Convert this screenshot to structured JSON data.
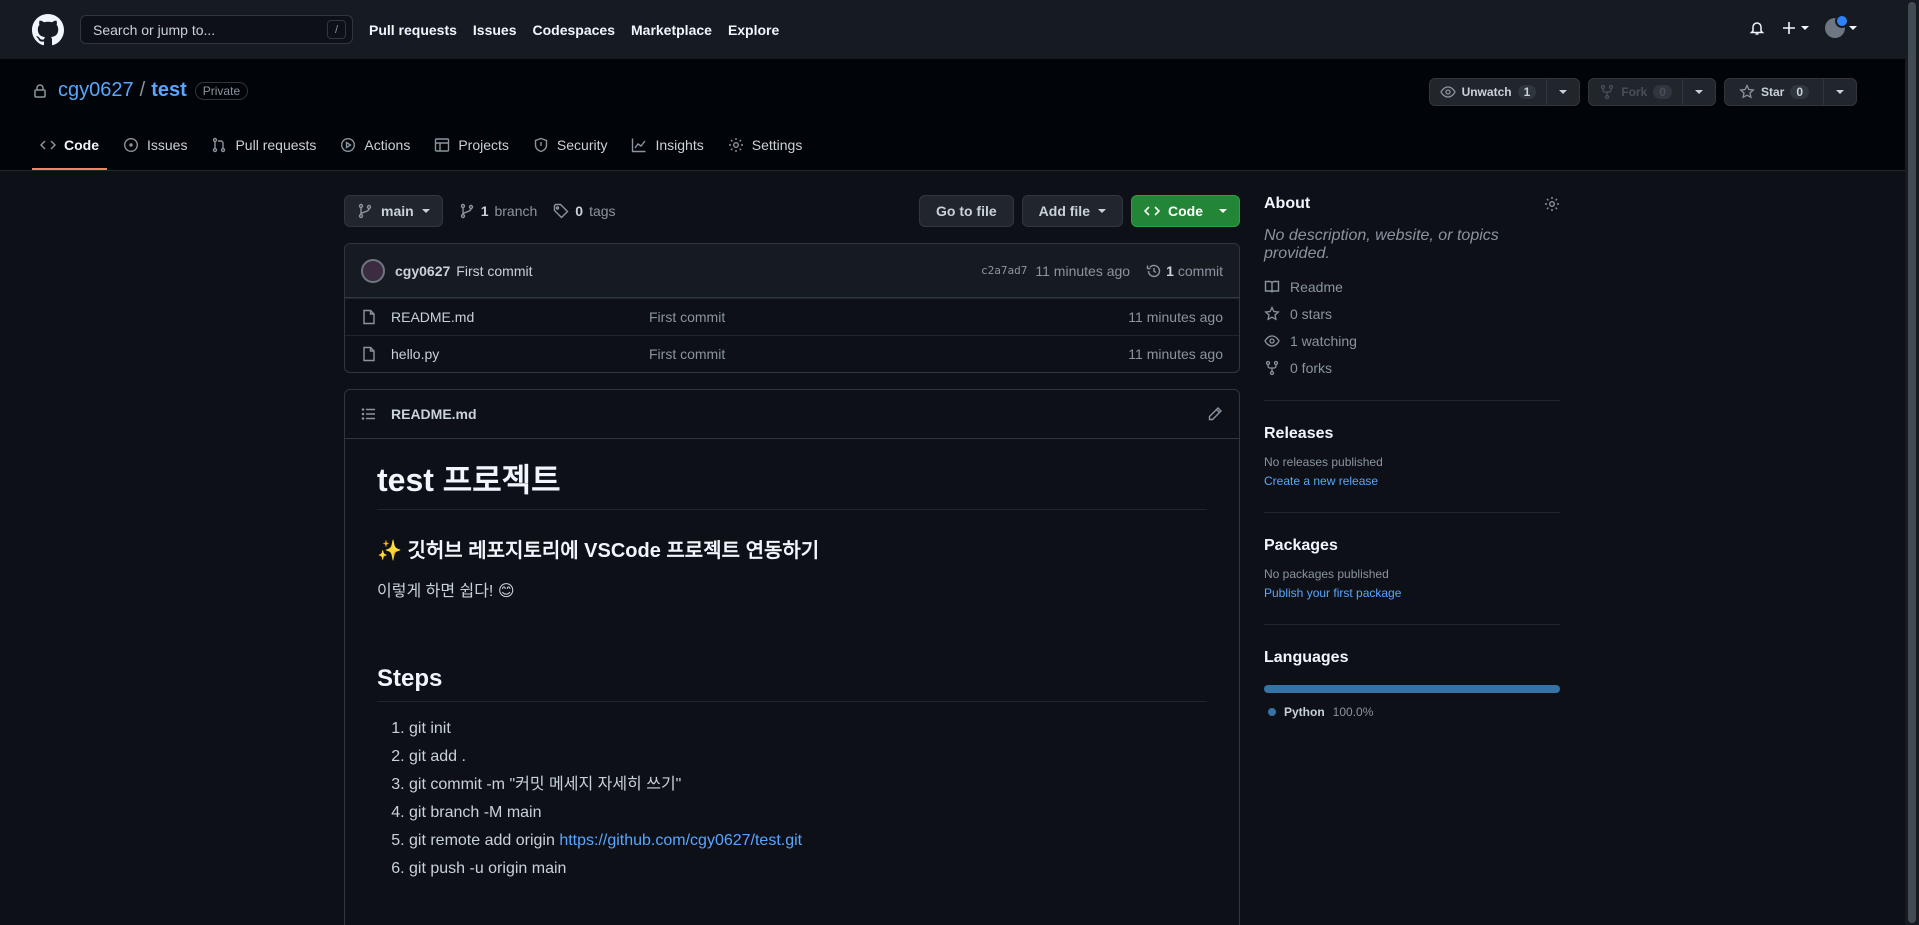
{
  "header": {
    "search_placeholder": "Search or jump to...",
    "slash_key": "/",
    "nav": [
      "Pull requests",
      "Issues",
      "Codespaces",
      "Marketplace",
      "Explore"
    ]
  },
  "repo": {
    "owner": "cgy0627",
    "name": "test",
    "visibility": "Private",
    "unwatch_label": "Unwatch",
    "watch_count": "1",
    "fork_label": "Fork",
    "fork_count": "0",
    "star_label": "Star",
    "star_count": "0",
    "tabs": [
      "Code",
      "Issues",
      "Pull requests",
      "Actions",
      "Projects",
      "Security",
      "Insights",
      "Settings"
    ]
  },
  "filenav": {
    "branch": "main",
    "branch_count": "1",
    "branch_label": "branch",
    "tag_count": "0",
    "tag_label": "tags",
    "goto_file": "Go to file",
    "add_file": "Add file",
    "code": "Code"
  },
  "commit": {
    "author": "cgy0627",
    "message": "First commit",
    "sha": "c2a7ad7",
    "time": "11 minutes ago",
    "count": "1",
    "count_label": "commit"
  },
  "files": [
    {
      "name": "README.md",
      "message": "First commit",
      "time": "11 minutes ago"
    },
    {
      "name": "hello.py",
      "message": "First commit",
      "time": "11 minutes ago"
    }
  ],
  "readme": {
    "filename": "README.md",
    "h1": "test 프로젝트",
    "h3": "✨ 깃허브 레포지토리에 VSCode 프로젝트 연동하기",
    "p": "이렇게 하면 쉽다! 😊",
    "h2": "Steps",
    "steps": [
      {
        "text": "git init"
      },
      {
        "text": "git add ."
      },
      {
        "text": "git commit -m \"커밋 메세지 자세히 쓰기\""
      },
      {
        "text": "git branch -M main"
      },
      {
        "text": "git remote add origin ",
        "link": "https://github.com/cgy0627/test.git"
      },
      {
        "text": "git push -u origin main"
      }
    ]
  },
  "about": {
    "title": "About",
    "description": "No description, website, or topics provided.",
    "readme": "Readme",
    "stars": "0 stars",
    "watching": "1 watching",
    "forks": "0 forks"
  },
  "releases": {
    "title": "Releases",
    "none": "No releases published",
    "link": "Create a new release"
  },
  "packages": {
    "title": "Packages",
    "none": "No packages published",
    "link": "Publish your first package"
  },
  "languages": {
    "title": "Languages",
    "items": [
      {
        "name": "Python",
        "percent": "100.0%",
        "color": "#3572a5"
      }
    ]
  }
}
